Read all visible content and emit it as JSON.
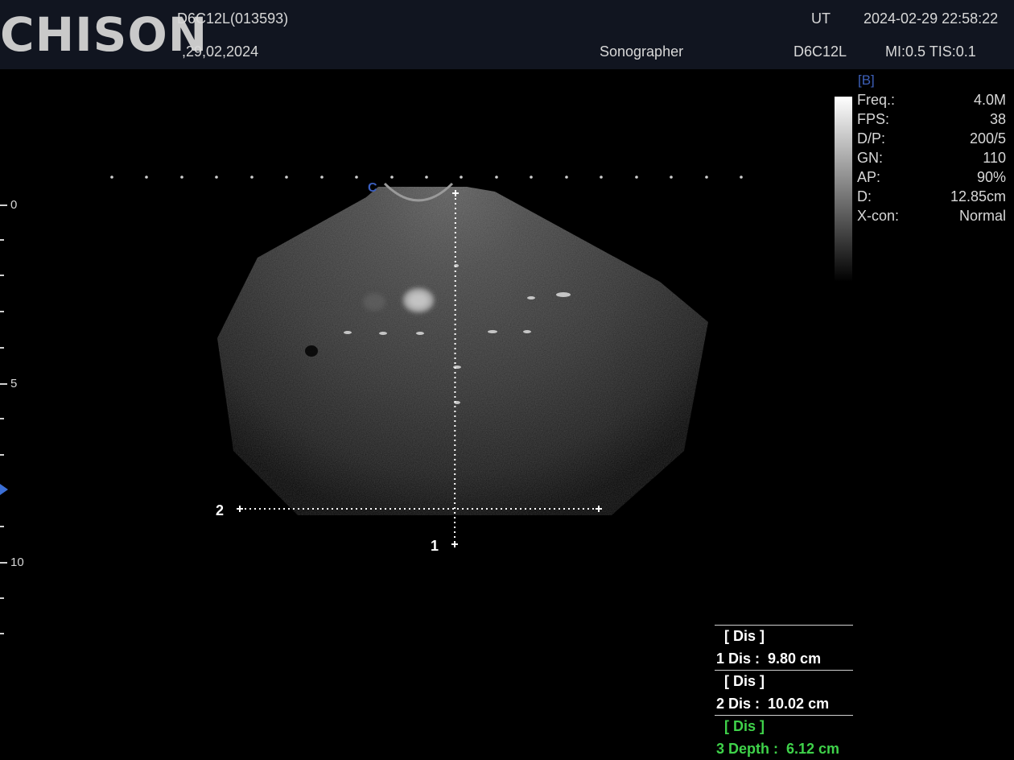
{
  "header": {
    "logo": "CHISON",
    "probe_id": "D6C12L(013593)",
    "date_short": ",29,02,2024",
    "mode": "UT",
    "datetime": "2024-02-29 22:58:22",
    "operator": "Sonographer",
    "probe": "D6C12L",
    "indices": "MI:0.5 TIS:0.1"
  },
  "depth_scale": {
    "labels": [
      "0",
      "5",
      "10"
    ],
    "unit": "cm",
    "focus_marker_color": "#3b6fd6"
  },
  "params": {
    "mode_label": "[B]",
    "rows": [
      {
        "label": "Freq.:",
        "value": "4.0M"
      },
      {
        "label": "FPS:",
        "value": "38"
      },
      {
        "label": "D/P:",
        "value": "200/5"
      },
      {
        "label": "GN:",
        "value": "110"
      },
      {
        "label": "AP:",
        "value": "90%"
      },
      {
        "label": "D:",
        "value": "12.85cm"
      },
      {
        "label": "X-con:",
        "value": "Normal"
      }
    ]
  },
  "image_overlay": {
    "probe_marker": "C",
    "caliper_1": "1",
    "caliper_2": "2"
  },
  "results": {
    "entries": [
      {
        "header": "  [ Dis ]",
        "line": "1 Dis :  9.80 cm",
        "color": "#ffffff"
      },
      {
        "header": "  [ Dis ]",
        "line": "2 Dis :  10.02 cm",
        "color": "#ffffff"
      },
      {
        "header": "  [ Dis ]",
        "line": "3 Depth :  6.12 cm",
        "color": "#3fd24a"
      }
    ]
  },
  "colors": {
    "header_bg": "#111520",
    "accent_blue": "#3b5fbf",
    "measurement_active": "#3fd24a"
  }
}
